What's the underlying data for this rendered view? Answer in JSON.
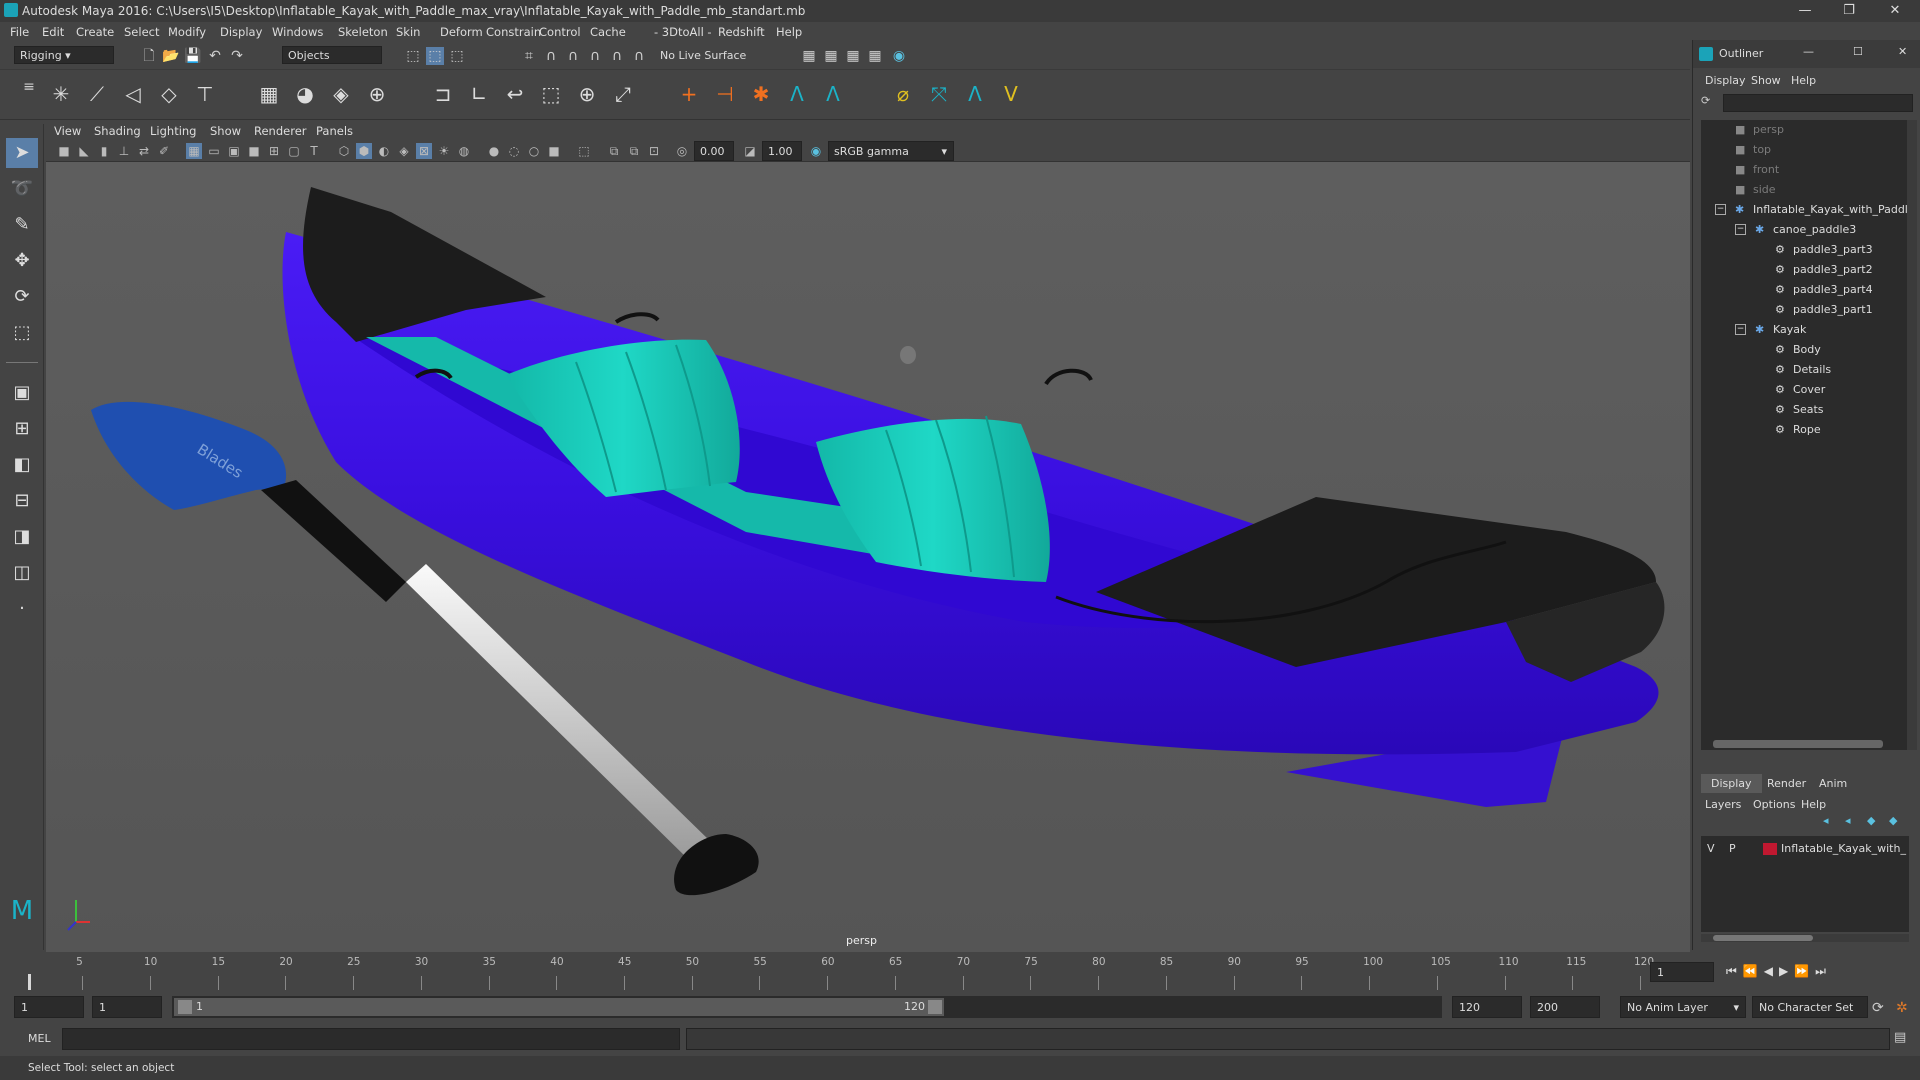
{
  "window": {
    "title": "Autodesk Maya 2016: C:\\Users\\I5\\Desktop\\Inflatable_Kayak_with_Paddle_max_vray\\Inflatable_Kayak_with_Paddle_mb_standart.mb"
  },
  "menubar": [
    "File",
    "Edit",
    "Create",
    "Select",
    "Modify",
    "Display",
    "Windows",
    "Skeleton",
    "Skin",
    "Deform",
    "Constrain",
    "Control",
    "Cache",
    "- 3DtoAll -",
    "Redshift",
    "Help"
  ],
  "statusline": {
    "mode": "Rigging",
    "selection_mode": "Objects",
    "live_surface": "No Live Surface"
  },
  "panel_menu": [
    "View",
    "Shading",
    "Lighting",
    "Show",
    "Renderer",
    "Panels"
  ],
  "panel_toolbar": {
    "exposure": "0.00",
    "gamma": "1.00",
    "color_space": "sRGB gamma"
  },
  "viewport": {
    "camera_label": "persp"
  },
  "outliner": {
    "title": "Outliner",
    "menu": [
      "Display",
      "Show",
      "Help"
    ],
    "items": [
      {
        "label": "persp",
        "dim": true,
        "indent": 0
      },
      {
        "label": "top",
        "dim": true,
        "indent": 0
      },
      {
        "label": "front",
        "dim": true,
        "indent": 0
      },
      {
        "label": "side",
        "dim": true,
        "indent": 0
      },
      {
        "label": "Inflatable_Kayak_with_Paddle",
        "dim": false,
        "indent": 0
      },
      {
        "label": "canoe_paddle3",
        "dim": false,
        "indent": 1
      },
      {
        "label": "paddle3_part3",
        "dim": false,
        "indent": 2
      },
      {
        "label": "paddle3_part2",
        "dim": false,
        "indent": 2
      },
      {
        "label": "paddle3_part4",
        "dim": false,
        "indent": 2
      },
      {
        "label": "paddle3_part1",
        "dim": false,
        "indent": 2
      },
      {
        "label": "Kayak",
        "dim": false,
        "indent": 1
      },
      {
        "label": "Body",
        "dim": false,
        "indent": 2
      },
      {
        "label": "Details",
        "dim": false,
        "indent": 2
      },
      {
        "label": "Cover",
        "dim": false,
        "indent": 2
      },
      {
        "label": "Seats",
        "dim": false,
        "indent": 2
      },
      {
        "label": "Rope",
        "dim": false,
        "indent": 2
      }
    ]
  },
  "layers": {
    "tabs": [
      "Display",
      "Render",
      "Anim"
    ],
    "menu": [
      "Layers",
      "Options",
      "Help"
    ],
    "row": {
      "v": "V",
      "p": "P",
      "name": "Inflatable_Kayak_with_",
      "color": "#c01830"
    }
  },
  "timeline": {
    "ticks": [
      "1",
      "5",
      "10",
      "15",
      "20",
      "25",
      "30",
      "35",
      "40",
      "45",
      "50",
      "55",
      "60",
      "65",
      "70",
      "75",
      "80",
      "85",
      "90",
      "95",
      "100",
      "105",
      "110",
      "115",
      "120"
    ],
    "current_frame": "1"
  },
  "range": {
    "start": "1",
    "start_inner": "1",
    "slider_start": "1",
    "slider_end": "120",
    "end_inner": "120",
    "end": "200",
    "anim_layer": "No Anim Layer",
    "char_set": "No Character Set"
  },
  "cmdline": {
    "lang": "MEL"
  },
  "helpline": {
    "text": "Select Tool: select an object"
  },
  "colors": {
    "kayak_body": "#3b10e8",
    "seats": "#17c9b8",
    "cover": "#1c1c1c",
    "paddle_blade": "#1f4fb0"
  }
}
